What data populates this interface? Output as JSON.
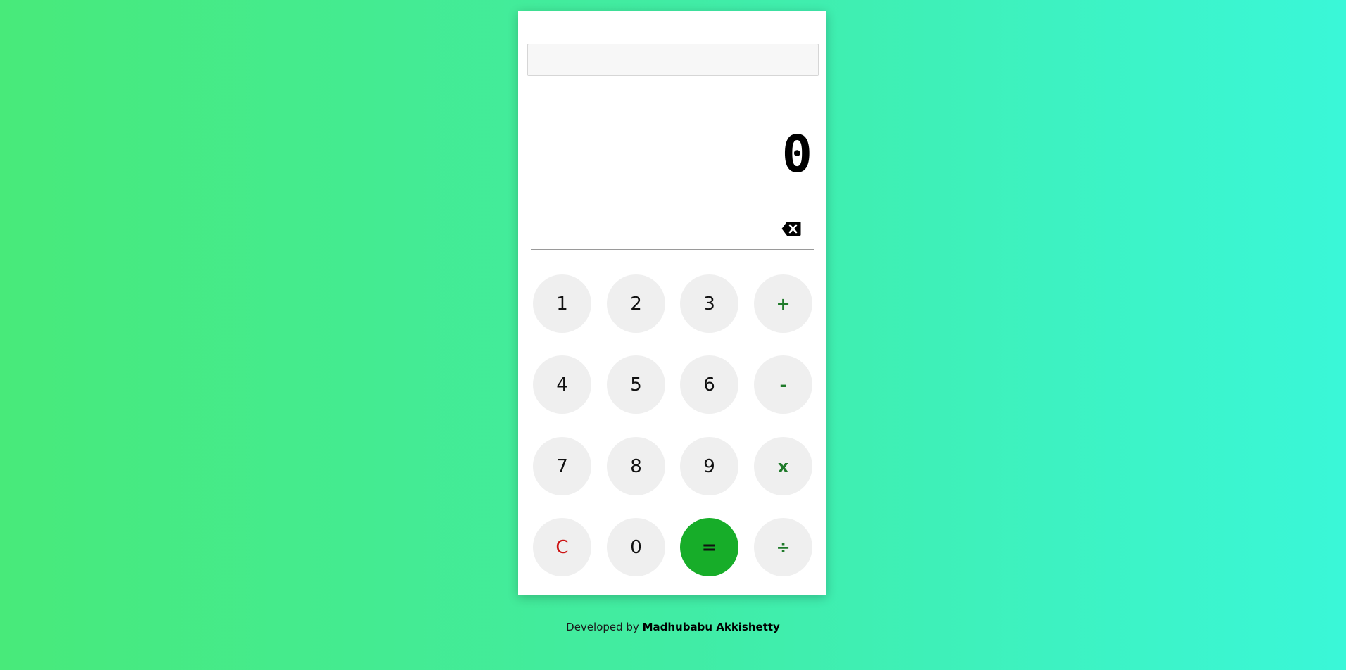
{
  "history": {
    "value": "",
    "placeholder": ""
  },
  "display": {
    "value": "0"
  },
  "keys": {
    "k1": "1",
    "k2": "2",
    "k3": "3",
    "plus": "+",
    "k4": "4",
    "k5": "5",
    "k6": "6",
    "minus": "-",
    "k7": "7",
    "k8": "8",
    "k9": "9",
    "multiply": "x",
    "clear": "C",
    "k0": "0",
    "equals": "=",
    "divide": "÷"
  },
  "icons": {
    "backspace": "backspace-icon"
  },
  "colors": {
    "operator": "#1f7a2a",
    "clear": "#cc1111",
    "equals_bg": "#17ad29",
    "key_bg": "#efefef"
  },
  "footer": {
    "prefix": "Developed by",
    "author": "Madhubabu Akkishetty"
  }
}
